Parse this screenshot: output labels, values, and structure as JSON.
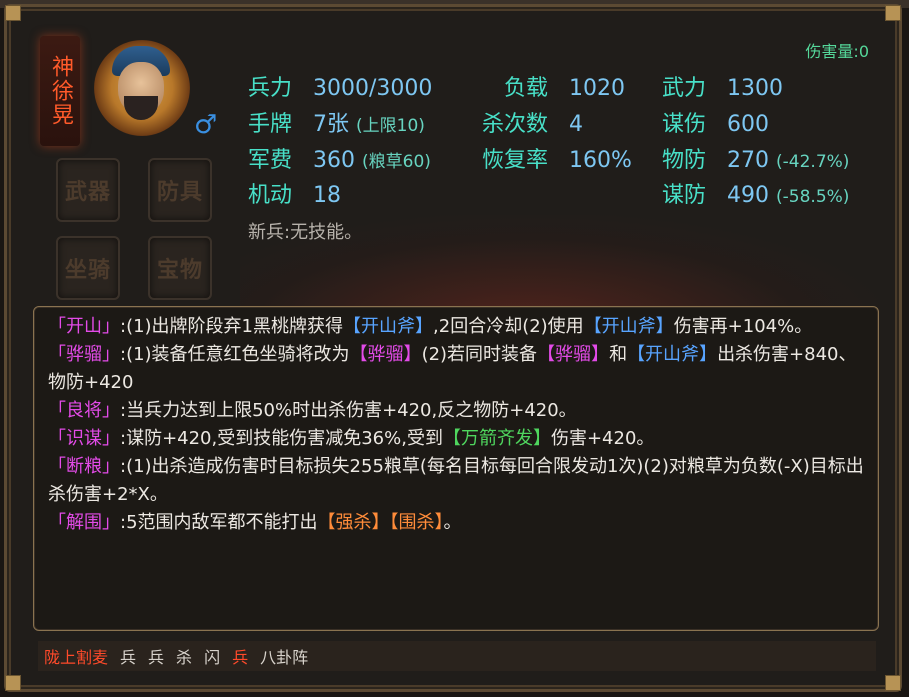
{
  "hero": {
    "name": "神徐晃",
    "gender_symbol": "♂"
  },
  "equipment_slots": [
    "武器",
    "防具",
    "坐骑",
    "宝物"
  ],
  "damage": "伤害量:0",
  "stats": {
    "troops_label": "兵力",
    "troops_value": "3000/3000",
    "hand_label": "手牌",
    "hand_value": "7张",
    "hand_sub": "(上限10)",
    "cost_label": "军费",
    "cost_value": "360",
    "cost_sub": "(粮草60)",
    "mobility_label": "机动",
    "mobility_value": "18",
    "load_label": "负载",
    "load_value": "1020",
    "kill_label": "杀次数",
    "kill_value": "4",
    "recovery_label": "恢复率",
    "recovery_value": "160%",
    "force_label": "武力",
    "force_value": "1300",
    "strategy_label": "谋伤",
    "strategy_value": "600",
    "pdef_label": "物防",
    "pdef_value": "270",
    "pdef_sub": "(-42.7%)",
    "sdef_label": "谋防",
    "sdef_value": "490",
    "sdef_sub": "(-58.5%)"
  },
  "soldier_skill": "新兵:无技能。",
  "skills": [
    {
      "name": "「开山」",
      "parts": [
        {
          "t": ":(1)出牌阶段弃1黑桃牌获得",
          "c": "white"
        },
        {
          "t": "【开山斧】",
          "c": "blue"
        },
        {
          "t": ",2回合冷却(2)使用",
          "c": "white"
        },
        {
          "t": "【开山斧】",
          "c": "blue"
        },
        {
          "t": "伤害再+104%。",
          "c": "white"
        }
      ]
    },
    {
      "name": "「骅骝」",
      "parts": [
        {
          "t": ":(1)装备任意红色坐骑将改为",
          "c": "white"
        },
        {
          "t": "【骅骝】",
          "c": "pink"
        },
        {
          "t": "(2)若同时装备",
          "c": "white"
        },
        {
          "t": "【骅骝】",
          "c": "pink"
        },
        {
          "t": "和",
          "c": "white"
        },
        {
          "t": "【开山斧】",
          "c": "blue"
        },
        {
          "t": "出杀伤害+840、物防+420",
          "c": "white"
        }
      ]
    },
    {
      "name": "「良将」",
      "parts": [
        {
          "t": ":当兵力达到上限50%时出杀伤害+420,反之物防+420。",
          "c": "white"
        }
      ]
    },
    {
      "name": "「识谋」",
      "parts": [
        {
          "t": ":谋防+420,受到技能伤害减免36%,受到",
          "c": "white"
        },
        {
          "t": "【万箭齐发】",
          "c": "green"
        },
        {
          "t": "伤害+420。",
          "c": "white"
        }
      ]
    },
    {
      "name": "「断粮」",
      "parts": [
        {
          "t": ":(1)出杀造成伤害时目标损失255粮草(每名目标每回合限发动1次)(2)对粮草为负数(-X)目标出杀伤害+2*X。",
          "c": "white"
        }
      ]
    },
    {
      "name": "「解围」",
      "parts": [
        {
          "t": ":5范围内敌军都不能打出",
          "c": "white"
        },
        {
          "t": "【强杀】",
          "c": "orange"
        },
        {
          "t": "【围杀】",
          "c": "orange"
        },
        {
          "t": "。",
          "c": "white"
        }
      ]
    }
  ],
  "bottom_bar": [
    {
      "t": "陇上割麦",
      "c": "red"
    },
    {
      "t": "兵",
      "c": "white"
    },
    {
      "t": "兵",
      "c": "white"
    },
    {
      "t": "杀",
      "c": "white"
    },
    {
      "t": "闪",
      "c": "white"
    },
    {
      "t": "兵",
      "c": "red"
    },
    {
      "t": "八卦阵",
      "c": "white"
    }
  ],
  "colors": {
    "label": "#48e0c8",
    "value": "#7ec7f2",
    "skill_name": "#e34be8",
    "blue": "#58a4ff",
    "green": "#4fd65e",
    "orange": "#ff8c3a",
    "red": "#ff4a2a"
  }
}
